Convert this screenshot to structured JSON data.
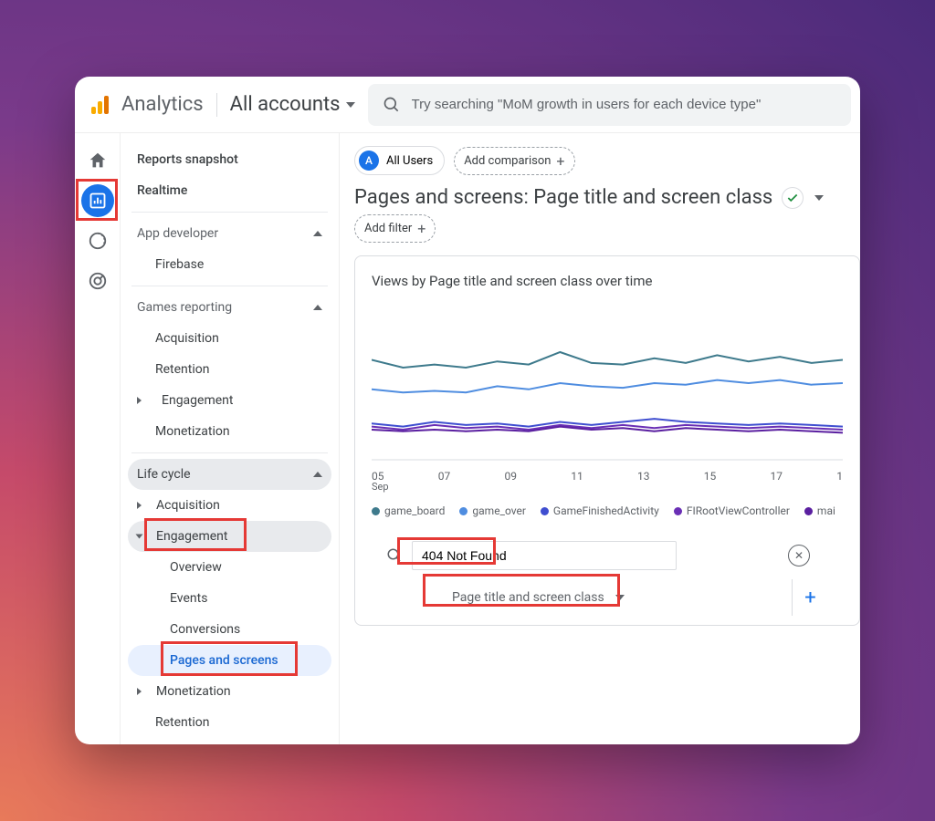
{
  "header": {
    "brand": "Analytics",
    "account_label": "All accounts",
    "search_placeholder": "Try searching \"MoM growth in users for each device type\""
  },
  "sidebar": {
    "snapshot": "Reports snapshot",
    "realtime": "Realtime",
    "app_dev": "App developer",
    "firebase": "Firebase",
    "games": "Games reporting",
    "games_items": {
      "acq": "Acquisition",
      "ret": "Retention",
      "eng": "Engagement",
      "mon": "Monetization"
    },
    "life": "Life cycle",
    "life_acq": "Acquisition",
    "life_eng": "Engagement",
    "eng_sub": {
      "ov": "Overview",
      "ev": "Events",
      "cv": "Conversions",
      "ps": "Pages and screens"
    },
    "life_mon": "Monetization",
    "life_ret": "Retention"
  },
  "main": {
    "all_users": "All Users",
    "add_comparison": "Add comparison",
    "title": "Pages and screens: Page title and screen class",
    "add_filter": "Add filter",
    "card_title": "Views by Page title and screen class over time",
    "search_value": "404 Not Found",
    "dimension": "Page title and screen class"
  },
  "chart_data": {
    "type": "line",
    "xlabel": "Sep",
    "categories": [
      "05",
      "07",
      "09",
      "11",
      "13",
      "15",
      "17",
      "1"
    ],
    "series": [
      {
        "name": "game_board",
        "color": "#3e7a8c",
        "values": [
          65,
          60,
          62,
          60,
          64,
          62,
          70,
          63,
          62,
          66,
          63,
          68,
          64,
          67,
          63,
          65
        ]
      },
      {
        "name": "game_over",
        "color": "#4f8de0",
        "values": [
          46,
          44,
          45,
          44,
          48,
          46,
          50,
          48,
          47,
          50,
          49,
          52,
          50,
          52,
          49,
          50
        ]
      },
      {
        "name": "GameFinishedActivity",
        "color": "#3f4ed0",
        "values": [
          24,
          22,
          25,
          23,
          24,
          22,
          25,
          23,
          25,
          27,
          25,
          24,
          23,
          24,
          23,
          22
        ]
      },
      {
        "name": "FIRootViewController",
        "color": "#6a2fb5",
        "values": [
          22,
          20,
          23,
          21,
          22,
          20,
          23,
          21,
          23,
          21,
          23,
          22,
          21,
          22,
          21,
          20
        ]
      },
      {
        "name": "mai",
        "color": "#5a1fa0",
        "values": [
          20,
          19,
          20,
          19,
          20,
          19,
          22,
          20,
          21,
          19,
          21,
          20,
          19,
          20,
          19,
          18
        ]
      }
    ],
    "ylim": [
      0,
      100
    ]
  }
}
